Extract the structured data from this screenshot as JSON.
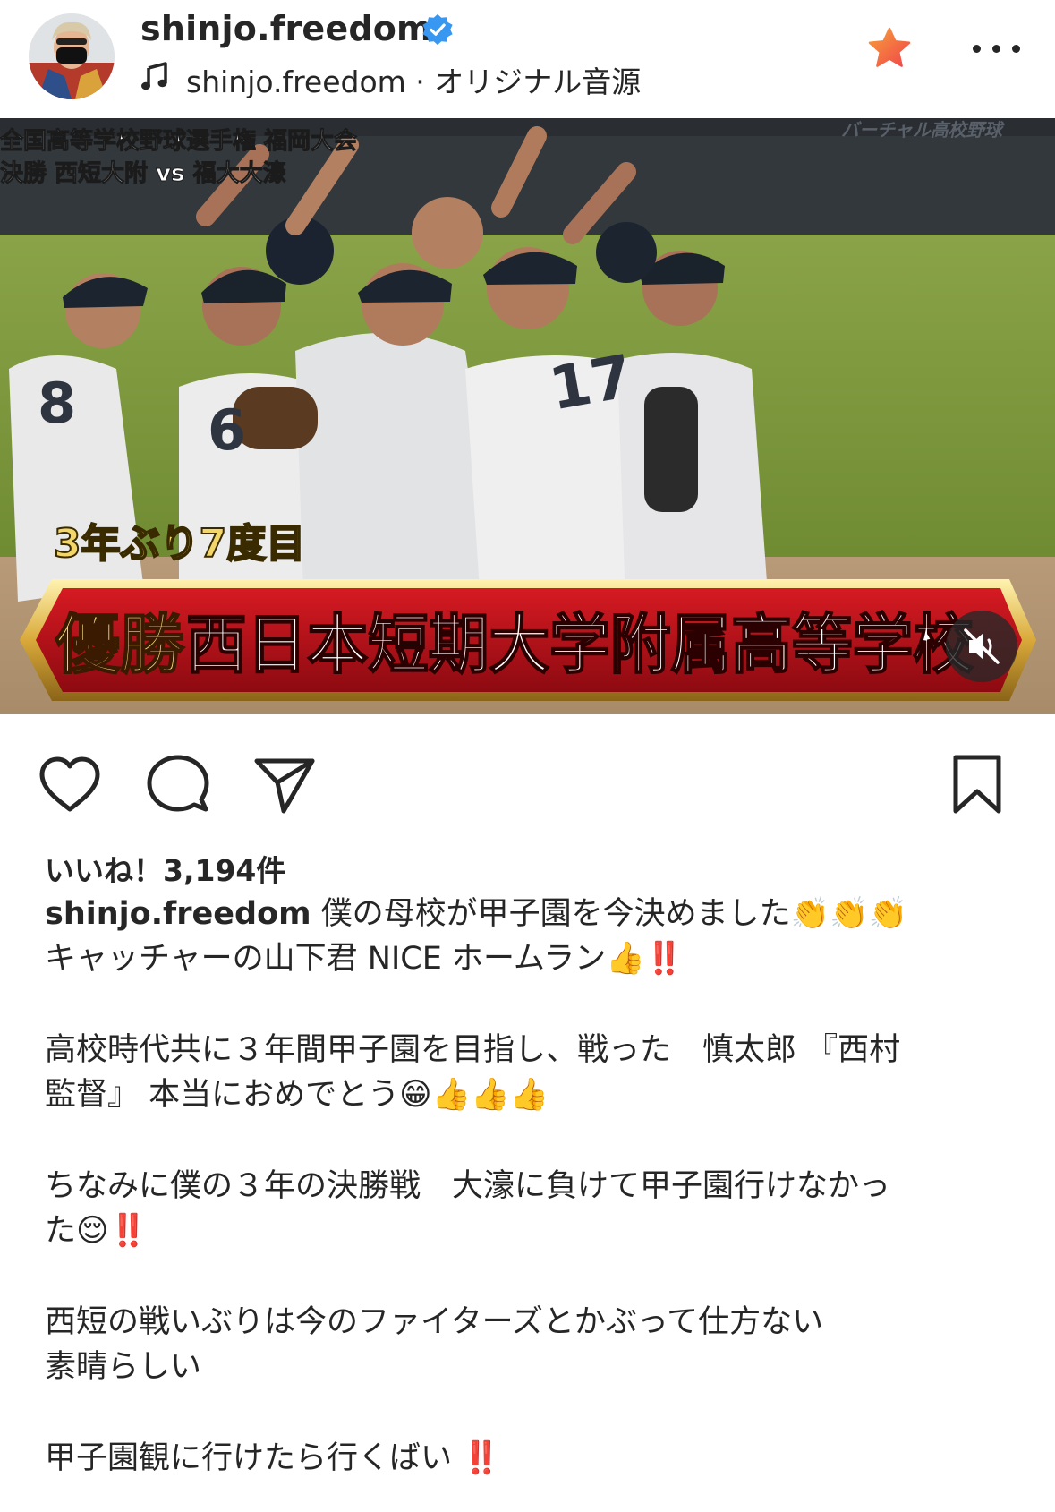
{
  "post": {
    "username": "shinjo.freedom",
    "audio_label": "shinjo.freedom · オリジナル音源",
    "likes_text": "いいね！3,194件"
  },
  "video_overlay": {
    "top_caption_line1": "全国高等学校野球選手権 福岡大会",
    "top_caption_line2": "決勝 西短大附 vs 福大大濠",
    "top_right_logo": "バーチャル高校野球",
    "subtitle": "3年ぶり7度目",
    "banner_prefix": "優勝",
    "banner_school": "西日本短期大学附属高等学校",
    "jersey_numbers": [
      "8",
      "6",
      "17"
    ]
  },
  "caption": {
    "user": "shinjo.freedom",
    "line1": " 僕の母校が甲子園を今決めました👏👏👏",
    "line2": "キャッチャーの山下君 NICE ホームラン👍‼️",
    "line3": "高校時代共に３年間甲子園を目指し、戦った　慎太郎 『西村",
    "line4": "監督』 本当におめでとう😁👍👍👍",
    "line5": "ちなみに僕の３年の決勝戦　大濠に負けて甲子園行けなかっ",
    "line6": "た😌‼️",
    "line7": "西短の戦いぶりは今のファイターズとかぶって仕方ない",
    "line8": "素晴らしい",
    "line9": "甲子園観に行けたら行くばい ‼️"
  },
  "icons": {
    "verified": "verified-badge-icon",
    "music": "music-note-icon",
    "star": "favorite-star-icon",
    "more": "more-options-icon",
    "mute": "muted-speaker-icon",
    "like": "heart-icon",
    "comment": "comment-icon",
    "share": "send-icon",
    "save": "bookmark-icon"
  },
  "colors": {
    "verified_blue": "#3897f0",
    "star_orange": "#fb6a3c",
    "banner_red": "#c8101c",
    "banner_gold": "#e7c25a"
  }
}
